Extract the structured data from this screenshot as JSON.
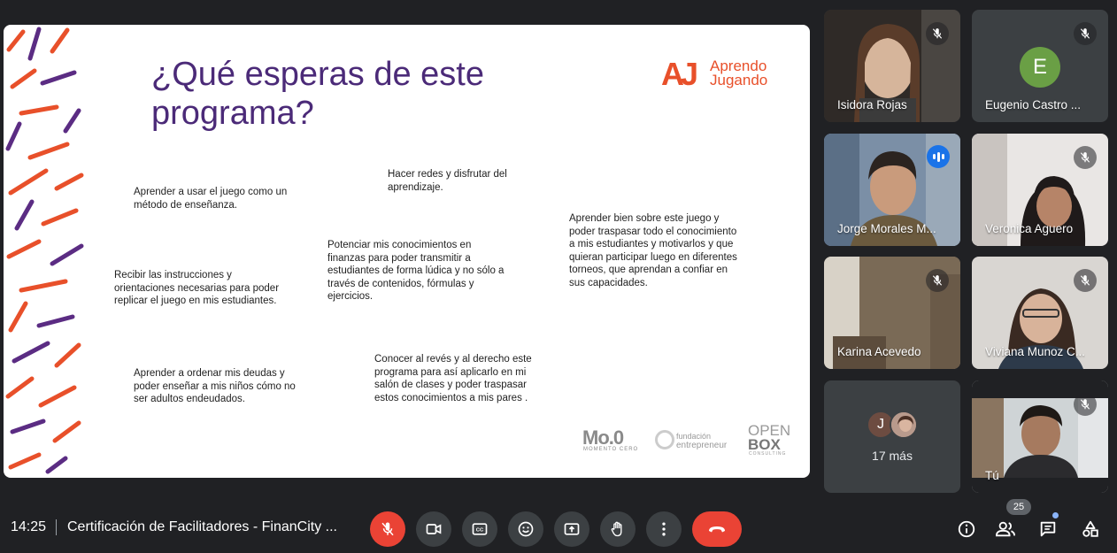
{
  "slide": {
    "title": "¿Qué esperas de este programa?",
    "brand_mark": "AJ",
    "brand_line1": "Aprendo",
    "brand_line2": "Jugando",
    "bubbles": [
      "Aprender a usar el juego como un método de enseñanza.",
      "Recibir las instrucciones y orientaciones necesarias para poder replicar el juego en mis estudiantes.",
      "Aprender a ordenar mis deudas y poder enseñar a mis niños cómo no ser adultos endeudados.",
      "Hacer redes y disfrutar del aprendizaje.",
      "Potenciar mis conocimientos en finanzas para poder transmitir a estudiantes de forma lúdica y no sólo a través de contenidos, fórmulas y ejercicios.",
      "Conocer al revés y al derecho este programa para así aplicarlo en mi salón de clases y poder traspasar estos conocimientos a mis pares .",
      "Aprender bien sobre este juego y poder traspasar todo el conocimiento a mis estudiantes y motivarlos y que quieran participar luego en diferentes torneos, que aprendan a confiar en sus capacidades."
    ],
    "sponsors": {
      "momento_cero": "Mo.0",
      "momento_cero_sub": "MOMENTO CERO",
      "fundacion_line1": "fundación",
      "fundacion_line2": "entrepreneur",
      "openbox_line1": "OPEN",
      "openbox_line2": "BOX",
      "openbox_sub": "CONSULTING"
    }
  },
  "participants": [
    {
      "name": "Isidora Rojas",
      "muted": true
    },
    {
      "name": "Eugenio Castro ...",
      "muted": true,
      "initial": "E"
    },
    {
      "name": "Jorge Morales M...",
      "muted": false,
      "speaking": true
    },
    {
      "name": "Veronica Aguero",
      "muted": true
    },
    {
      "name": "Karina Acevedo",
      "muted": true
    },
    {
      "name": "Viviana Munoz C...",
      "muted": true
    },
    {
      "name": "Tú",
      "muted": true
    }
  ],
  "more": {
    "initial": "J",
    "label": "17 más"
  },
  "bottombar": {
    "time": "14:25",
    "meeting_title": "Certificación de Facilitadores - FinanCity ...",
    "people_count": "25"
  },
  "colors": {
    "accent_blue": "#8ab4f8",
    "red": "#ea4335",
    "slide_title": "#4b2a78",
    "brand_orange": "#e8502a"
  }
}
